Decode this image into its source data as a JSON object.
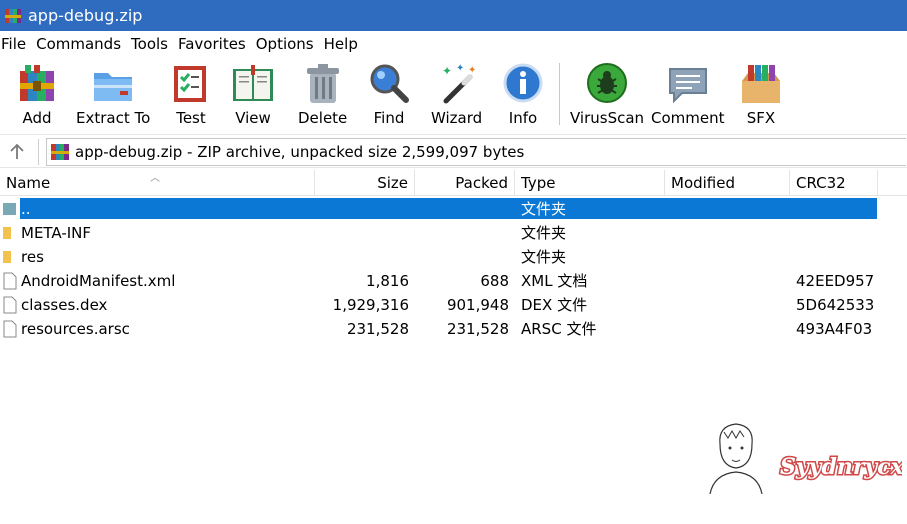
{
  "window": {
    "title": "app-debug.zip"
  },
  "menu": [
    "File",
    "Commands",
    "Tools",
    "Favorites",
    "Options",
    "Help"
  ],
  "toolbar": [
    {
      "id": "add",
      "label": "Add",
      "icon": "add-archive-icon"
    },
    {
      "id": "extract-to",
      "label": "Extract To",
      "icon": "extract-folder-icon"
    },
    {
      "id": "test",
      "label": "Test",
      "icon": "test-checklist-icon"
    },
    {
      "id": "view",
      "label": "View",
      "icon": "book-view-icon"
    },
    {
      "id": "delete",
      "label": "Delete",
      "icon": "trash-can-icon"
    },
    {
      "id": "find",
      "label": "Find",
      "icon": "magnifier-icon"
    },
    {
      "id": "wizard",
      "label": "Wizard",
      "icon": "magic-wand-icon"
    },
    {
      "id": "info",
      "label": "Info",
      "icon": "info-circle-icon"
    },
    {
      "id": "virusscan",
      "label": "VirusScan",
      "icon": "bug-scan-icon"
    },
    {
      "id": "comment",
      "label": "Comment",
      "icon": "speech-bubble-icon"
    },
    {
      "id": "sfx",
      "label": "SFX",
      "icon": "sfx-box-icon"
    }
  ],
  "address": {
    "text": "app-debug.zip - ZIP archive, unpacked size 2,599,097 bytes"
  },
  "columns": {
    "name": "Name",
    "size": "Size",
    "packed": "Packed",
    "type": "Type",
    "modified": "Modified",
    "crc": "CRC32"
  },
  "files": [
    {
      "name": "..",
      "size": "",
      "packed": "",
      "type": "文件夹",
      "modified": "",
      "crc": "",
      "icon": "parent-folder-icon",
      "selected": true
    },
    {
      "name": "META-INF",
      "size": "",
      "packed": "",
      "type": "文件夹",
      "modified": "",
      "crc": "",
      "icon": "folder-icon",
      "selected": false
    },
    {
      "name": "res",
      "size": "",
      "packed": "",
      "type": "文件夹",
      "modified": "",
      "crc": "",
      "icon": "folder-icon",
      "selected": false
    },
    {
      "name": "AndroidManifest.xml",
      "size": "1,816",
      "packed": "688",
      "type": "XML 文档",
      "modified": "",
      "crc": "42EED957",
      "icon": "file-icon",
      "selected": false
    },
    {
      "name": "classes.dex",
      "size": "1,929,316",
      "packed": "901,948",
      "type": "DEX 文件",
      "modified": "",
      "crc": "5D642533",
      "icon": "file-icon",
      "selected": false
    },
    {
      "name": "resources.arsc",
      "size": "231,528",
      "packed": "231,528",
      "type": "ARSC 文件",
      "modified": "",
      "crc": "493A4F03",
      "icon": "file-icon",
      "selected": false
    }
  ],
  "watermark": {
    "text": "Syydnrycx"
  },
  "colors": {
    "titlebar": "#2f6cbf",
    "selection": "#0a78d4",
    "folder": "#f2c14e"
  }
}
